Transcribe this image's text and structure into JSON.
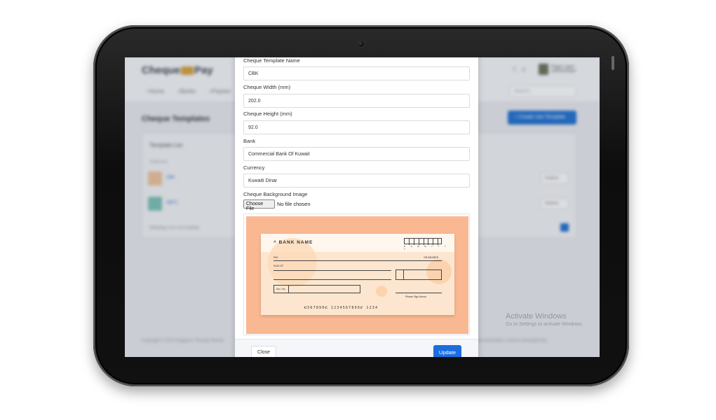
{
  "background_app": {
    "logo_left": "Cheque",
    "logo_right": "Pay",
    "nav": [
      "Home",
      "Banks",
      "Payees"
    ],
    "search_placeholder": "Search...",
    "user_name": "Pagar Laprn",
    "user_role": "Administrator",
    "page_title": "Cheque Templates",
    "create_button": "+ Create new Template",
    "card_header": "Template List",
    "column_header": "TEMPLATE",
    "rows": [
      {
        "name": "CBK",
        "action": "Actions",
        "thumb_color": "#f1c49a"
      },
      {
        "name": "HBTC",
        "action": "Actions",
        "thumb_color": "#7cc3b6"
      }
    ],
    "showing": "Showing 1 to 2 of 2 entries",
    "footer_left": "Copyright © 2020 Pagapour Temalar Rental",
    "footer_right": "Documentation   License   Developed By"
  },
  "windows_watermark": {
    "line1": "Activate Windows",
    "line2": "Go to Settings to activate Windows."
  },
  "modal": {
    "fields": [
      {
        "label": "Cheque Template Name",
        "value": "CBK"
      },
      {
        "label": "Cheque Width (mm)",
        "value": "202.0"
      },
      {
        "label": "Cheque Height (mm)",
        "value": "92.0"
      },
      {
        "label": "Bank",
        "value": "Commercial Bank Of Kuwait"
      },
      {
        "label": "Currency",
        "value": "Kuwaiti Dinar"
      }
    ],
    "bg_image_label": "Cheque Background Image",
    "choose_file": "Choose File",
    "no_file": "No file chosen",
    "cheque": {
      "bank_name": "BANK NAME",
      "date_letters": "D D M M Y Y Y Y",
      "pay": "PAY",
      "or_bearer": "OR BEARER",
      "sum_of": "SUM OF",
      "acc_no": "Acc. No.",
      "sign_above": "Please Sign Above",
      "micr": "⑆567890⑆   1234567890⑈   1234"
    },
    "close_label": "Close",
    "update_label": "Update"
  }
}
